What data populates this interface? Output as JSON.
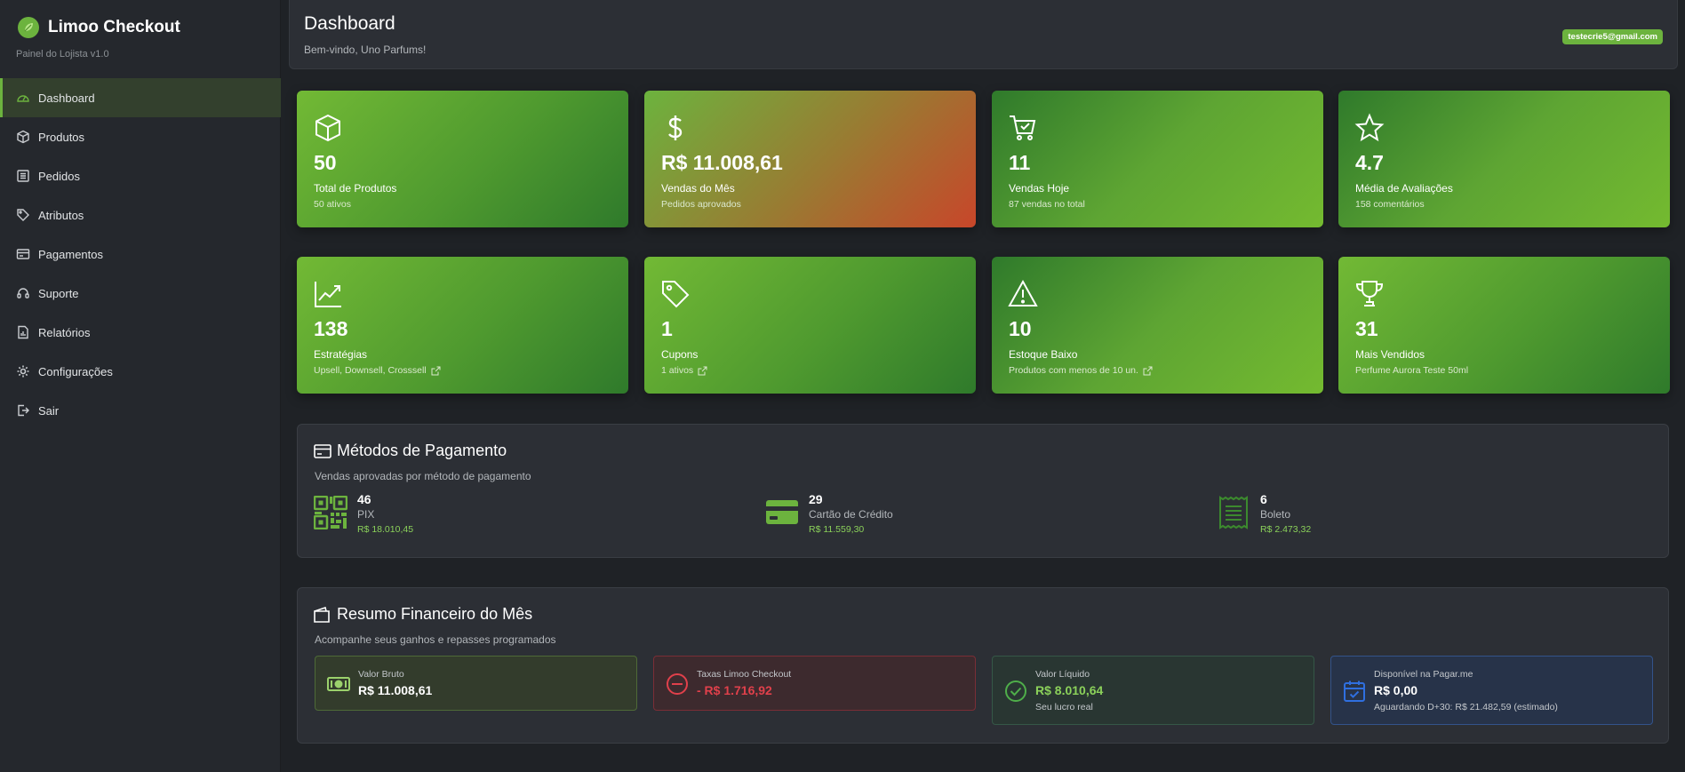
{
  "brand": {
    "title": "Limoo Checkout",
    "subtitle": "Painel do Lojista v1.0"
  },
  "sidebar": {
    "items": [
      {
        "label": "Dashboard",
        "icon": "gauge-icon",
        "active": true
      },
      {
        "label": "Produtos",
        "icon": "box-icon"
      },
      {
        "label": "Pedidos",
        "icon": "list-icon"
      },
      {
        "label": "Atributos",
        "icon": "tags-icon"
      },
      {
        "label": "Pagamentos",
        "icon": "credit-card-icon"
      },
      {
        "label": "Suporte",
        "icon": "headset-icon"
      },
      {
        "label": "Relatórios",
        "icon": "report-icon"
      },
      {
        "label": "Configurações",
        "icon": "gear-icon"
      },
      {
        "label": "Sair",
        "icon": "logout-icon"
      }
    ]
  },
  "header": {
    "title": "Dashboard",
    "welcome": "Bem-vindo, Uno Parfums!",
    "user_email": "testecrie5@gmail.com"
  },
  "cards": [
    {
      "value": "50",
      "label": "Total de Produtos",
      "sub": "50 ativos",
      "icon": "box-icon"
    },
    {
      "value": "R$ 11.008,61",
      "label": "Vendas do Mês",
      "sub": "Pedidos aprovados",
      "icon": "dollar-icon"
    },
    {
      "value": "11",
      "label": "Vendas Hoje",
      "sub": "87 vendas no total",
      "icon": "cart-check-icon"
    },
    {
      "value": "4.7",
      "label": "Média de Avaliações",
      "sub": "158 comentários",
      "icon": "star-icon"
    },
    {
      "value": "138",
      "label": "Estratégias",
      "sub": "Upsell, Downsell, Crosssell",
      "icon": "chart-line-icon",
      "external_link": true
    },
    {
      "value": "1",
      "label": "Cupons",
      "sub": "1 ativos",
      "icon": "tag-icon",
      "external_link": true
    },
    {
      "value": "10",
      "label": "Estoque Baixo",
      "sub": "Produtos com menos de 10 un.",
      "icon": "warning-icon",
      "external_link": true
    },
    {
      "value": "31",
      "label": "Mais Vendidos",
      "sub": "Perfume Aurora Teste 50ml",
      "icon": "trophy-icon"
    }
  ],
  "payment_methods": {
    "title": "Métodos de Pagamento",
    "subtitle": "Vendas aprovadas por método de pagamento",
    "items": [
      {
        "count": "46",
        "name": "PIX",
        "amount": "R$ 18.010,45",
        "icon": "qr-code-icon"
      },
      {
        "count": "29",
        "name": "Cartão de Crédito",
        "amount": "R$ 11.559,30",
        "icon": "credit-card-icon"
      },
      {
        "count": "6",
        "name": "Boleto",
        "amount": "R$ 2.473,32",
        "icon": "receipt-icon"
      }
    ]
  },
  "financial": {
    "title": "Resumo Financeiro do Mês",
    "subtitle": "Acompanhe seus ganhos e repasses programados",
    "items": [
      {
        "label": "Valor Bruto",
        "value": "R$ 11.008,61",
        "icon": "cash-icon"
      },
      {
        "label": "Taxas Limoo Checkout",
        "value": "- R$ 1.716,92",
        "icon": "minus-circle-icon"
      },
      {
        "label": "Valor Líquido",
        "value": "R$ 8.010,64",
        "note": "Seu lucro real",
        "icon": "check-circle-icon"
      },
      {
        "label": "Disponível na Pagar.me",
        "value": "R$ 0,00",
        "note": "Aguardando D+30: R$ 21.482,59 (estimado)",
        "icon": "calendar-check-icon"
      }
    ]
  },
  "colors": {
    "accent": "#6cb33e",
    "danger": "#e0404b",
    "success": "#8bd15a",
    "info": "#2f6fe0"
  }
}
